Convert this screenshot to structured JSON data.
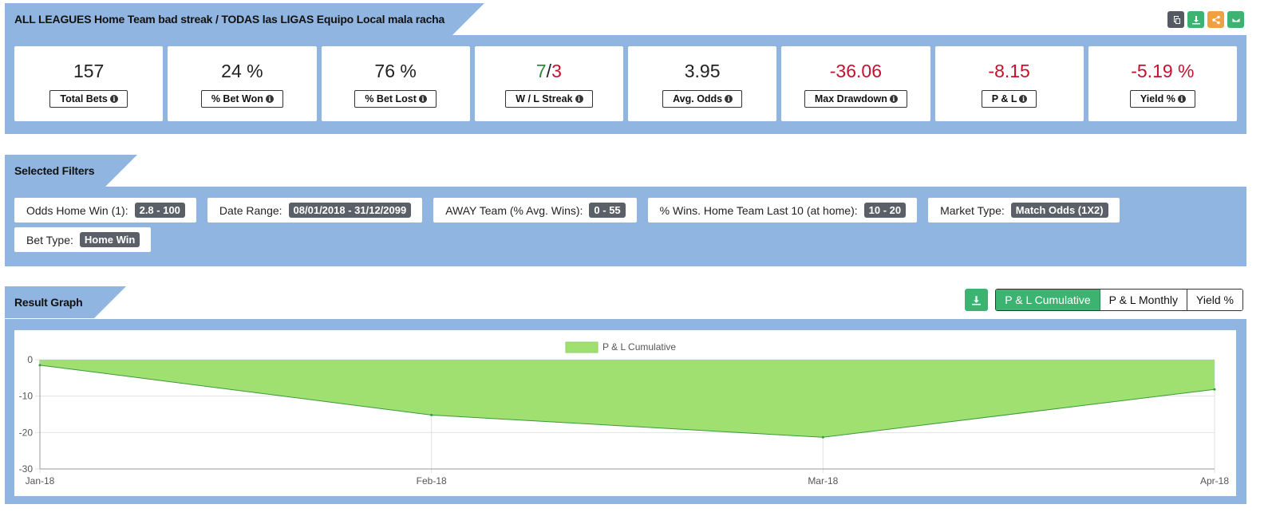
{
  "header": {
    "title": "ALL LEAGUES Home Team bad streak / TODAS las LIGAS Equipo Local mala racha",
    "icons": [
      {
        "name": "copy-icon",
        "color": "#555a62"
      },
      {
        "name": "download-icon",
        "color": "#3cb371"
      },
      {
        "name": "share-icon",
        "color": "#f0a040"
      },
      {
        "name": "email-icon",
        "color": "#3cb371"
      }
    ]
  },
  "stats": {
    "total_bets": {
      "value": "157",
      "label": "Total Bets"
    },
    "bet_won": {
      "value": "24 %",
      "label": "% Bet Won"
    },
    "bet_lost": {
      "value": "76 %",
      "label": "% Bet Lost"
    },
    "wl_streak": {
      "win": "7",
      "sep": "/",
      "loss": "3",
      "label": "W / L Streak"
    },
    "avg_odds": {
      "value": "3.95",
      "label": "Avg. Odds"
    },
    "max_drawdown": {
      "value": "-36.06",
      "label": "Max Drawdown"
    },
    "pl": {
      "value": "-8.15",
      "label": "P & L"
    },
    "yield": {
      "value": "-5.19 %",
      "label": "Yield %"
    }
  },
  "filters": {
    "title": "Selected Filters",
    "items": [
      {
        "label": "Odds Home Win (1):",
        "value": "2.8 - 100"
      },
      {
        "label": "Date Range:",
        "value": "08/01/2018 - 31/12/2099"
      },
      {
        "label": "AWAY Team (% Avg. Wins):",
        "value": "0 - 55"
      },
      {
        "label": "% Wins. Home Team Last 10 (at home):",
        "value": "10 - 20"
      },
      {
        "label": "Market Type:",
        "value": "Match Odds (1X2)"
      },
      {
        "label": "Bet Type:",
        "value": "Home Win"
      }
    ]
  },
  "graph": {
    "title": "Result Graph",
    "tabs": [
      "P & L Cumulative",
      "P & L Monthly",
      "Yield %"
    ],
    "active_tab": "P & L Cumulative"
  },
  "colors": {
    "panel": "#8fb5e0",
    "accent_green": "#3cb371",
    "area_fill": "#a0e070",
    "area_line": "#3a9a3a",
    "negative": "#c8102e"
  },
  "chart_data": {
    "type": "area",
    "x": [
      "Jan-18",
      "Feb-18",
      "Mar-18",
      "Apr-18"
    ],
    "series": [
      {
        "name": "P & L Cumulative",
        "values": [
          -1.5,
          -15.2,
          -21.3,
          -8.15
        ]
      }
    ],
    "yticks": [
      0,
      -10,
      -20,
      -30
    ],
    "ylim": [
      -30,
      0
    ],
    "legend": "top-center",
    "grid": true
  }
}
